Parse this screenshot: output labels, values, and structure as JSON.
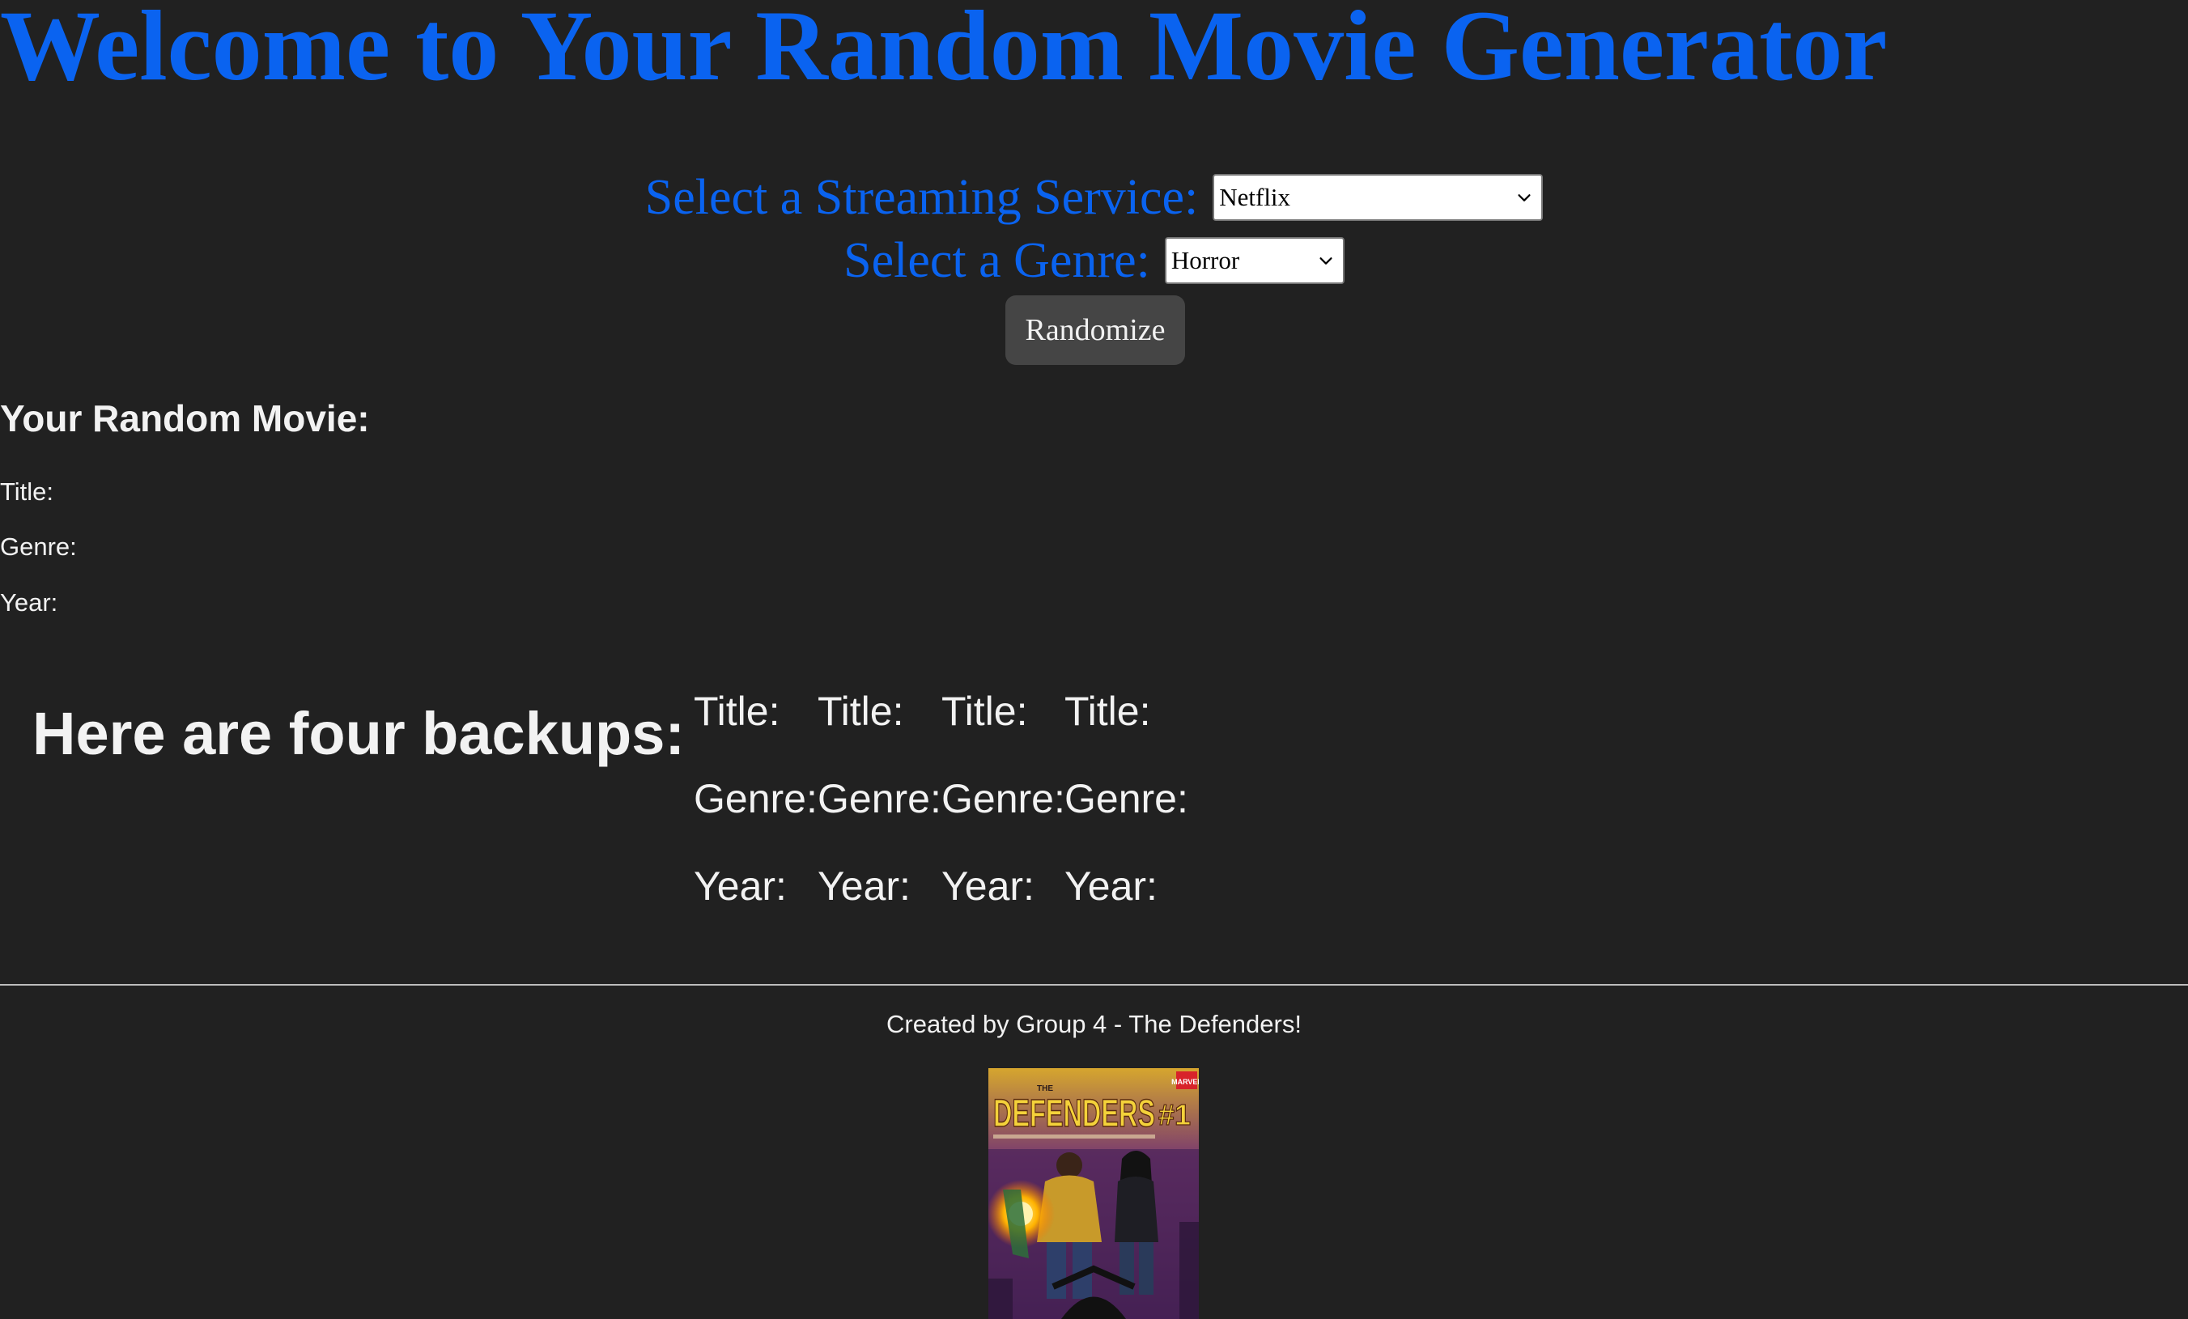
{
  "header": {
    "title": "Welcome to Your Random Movie Generator"
  },
  "form": {
    "service_label": "Select a Streaming Service:",
    "service_value": "Netflix",
    "genre_label": "Select a Genre:",
    "genre_value": "Horror",
    "randomize_label": "Randomize"
  },
  "result": {
    "heading": "Your Random Movie:",
    "title_label": "Title:",
    "genre_label": "Genre:",
    "year_label": "Year:"
  },
  "backups": {
    "heading": "Here are four backups:",
    "items": [
      {
        "title_label": "Title:",
        "genre_label": "Genre:",
        "year_label": "Year:"
      },
      {
        "title_label": "Title:",
        "genre_label": "Genre:",
        "year_label": "Year:"
      },
      {
        "title_label": "Title:",
        "genre_label": "Genre:",
        "year_label": "Year:"
      },
      {
        "title_label": "Title:",
        "genre_label": "Genre:",
        "year_label": "Year:"
      }
    ]
  },
  "footer": {
    "credit": "Created by Group 4 - The Defenders!",
    "poster": {
      "title": "DEFENDERS",
      "issue": "#1",
      "publisher": "MARVEL",
      "the": "THE"
    }
  },
  "colors": {
    "background": "#212121",
    "accent_blue": "#0a63f0",
    "button": "#454545"
  },
  "icons": {
    "select_arrow": "chevron-down-icon"
  }
}
